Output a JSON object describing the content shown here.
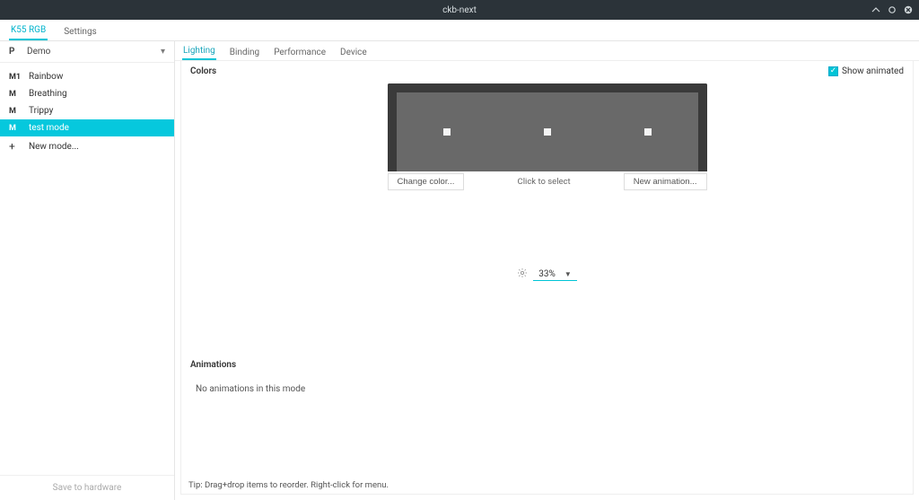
{
  "window": {
    "title": "ckb-next"
  },
  "tabs": [
    {
      "label": "K55 RGB",
      "active": true
    },
    {
      "label": "Settings",
      "active": false
    }
  ],
  "profile": {
    "letter": "P",
    "name": "Demo"
  },
  "modes": [
    {
      "tag": "M1",
      "label": "Rainbow",
      "selected": false
    },
    {
      "tag": "M",
      "label": "Breathing",
      "selected": false
    },
    {
      "tag": "M",
      "label": "Trippy",
      "selected": false
    },
    {
      "tag": "M",
      "label": "test mode",
      "selected": true
    },
    {
      "tag": "+",
      "label": "New mode...",
      "selected": false,
      "new": true
    }
  ],
  "saveHardware": "Save to hardware",
  "subtabs": [
    {
      "label": "Lighting",
      "active": true
    },
    {
      "label": "Binding",
      "active": false
    },
    {
      "label": "Performance",
      "active": false
    },
    {
      "label": "Device",
      "active": false
    }
  ],
  "colors": {
    "title": "Colors",
    "showAnimated": "Show animated",
    "changeColor": "Change color...",
    "clickToSelect": "Click to select",
    "newAnimation": "New animation..."
  },
  "brightness": {
    "value": "33%"
  },
  "animations": {
    "title": "Animations",
    "empty": "No animations in this mode"
  },
  "tip": "Tip: Drag+drop items to reorder. Right-click for menu."
}
